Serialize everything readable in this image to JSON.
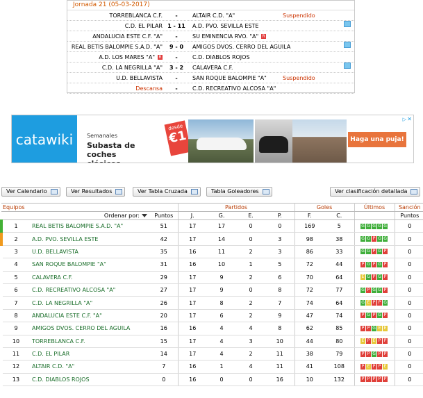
{
  "jornada": {
    "title": "Jornada 21 (05-03-2017)",
    "matches": [
      {
        "home": "TORREBLANCA C.F.",
        "score": "-",
        "away": "ALTAIR C.D. \"A\"",
        "status": "Suspendido",
        "badge": "",
        "icon": false
      },
      {
        "home": "C.D. EL PILAR",
        "score": "1 - 11",
        "away": "A.D. PVO. SEVILLA ESTE",
        "status": "",
        "badge": "",
        "icon": true
      },
      {
        "home": "ANDALUCIA ESTE C.F. \"A\"",
        "score": "-",
        "away": "SU EMINENCIA RVO. \"A\"",
        "status": "",
        "badge": "R",
        "icon": false
      },
      {
        "home": "REAL BETIS BALOMPIE S.A.D. \"A\"",
        "score": "9 - 0",
        "away": "AMIGOS DVOS. CERRO DEL AGUILA",
        "status": "",
        "badge": "",
        "icon": true
      },
      {
        "home": "A.D. LOS MARES \"A\"",
        "score": "-",
        "away": "C.D. DIABLOS ROJOS",
        "status": "",
        "badge": "R",
        "badge_home": true,
        "icon": false
      },
      {
        "home": "C.D. LA NEGRILLA \"A\"",
        "score": "3 - 2",
        "away": "CALAVERA C.F.",
        "status": "",
        "badge": "",
        "icon": true
      },
      {
        "home": "U.D. BELLAVISTA",
        "score": "-",
        "away": "SAN ROQUE BALOMPIE \"A\"",
        "status": "Suspendido",
        "badge": "",
        "icon": false
      },
      {
        "home": "Descansa",
        "score": "-",
        "away": "C.D. RECREATIVO ALCOSA \"A\"",
        "status": "",
        "badge": "",
        "icon": false,
        "descansa": true
      }
    ]
  },
  "ad": {
    "logo": "catawiki",
    "line1": "Semanales",
    "line2": "Subasta de coches clásicos",
    "price_prefix": "desde",
    "price": "€1",
    "cta": "Haga una puja! »",
    "info_icon": "info-icon",
    "close": "✕"
  },
  "buttons": {
    "calendario": "Ver Calendario",
    "resultados": "Ver Resultados",
    "cruzada": "Ver Tabla Cruzada",
    "goleadores": "Tabla Goleadores",
    "detallada": "Ver clasificación detallada"
  },
  "table": {
    "groups": {
      "equipos": "Equipos",
      "partidos": "Partidos",
      "goles": "Goles",
      "ultimos": "Últimos",
      "sancion": "Sanción"
    },
    "sub": {
      "ordenar": "Ordenar por:",
      "puntos": "Puntos",
      "j": "J.",
      "g": "G.",
      "e": "E.",
      "p": "P.",
      "f": "F.",
      "c": "C.",
      "sancion_puntos": "Puntos"
    },
    "rows": [
      {
        "pos": "1",
        "mark": "green",
        "team": "REAL BETIS BALOMPIE S.A.D. \"A\"",
        "pts": "51",
        "j": "17",
        "g": "17",
        "e": "0",
        "p": "0",
        "f": "169",
        "c": "5",
        "form": [
          "G",
          "G",
          "G",
          "G",
          "G"
        ],
        "san": "0"
      },
      {
        "pos": "2",
        "mark": "orange",
        "team": "A.D. PVO. SEVILLA ESTE",
        "pts": "42",
        "j": "17",
        "g": "14",
        "e": "0",
        "p": "3",
        "f": "98",
        "c": "38",
        "form": [
          "G",
          "G",
          "P",
          "G",
          "G"
        ],
        "san": "0"
      },
      {
        "pos": "3",
        "mark": "",
        "team": "U.D. BELLAVISTA",
        "pts": "35",
        "j": "16",
        "g": "11",
        "e": "2",
        "p": "3",
        "f": "86",
        "c": "33",
        "form": [
          "G",
          "G",
          "P",
          "G",
          "P"
        ],
        "san": "0"
      },
      {
        "pos": "4",
        "mark": "",
        "team": "SAN ROQUE BALOMPIE \"A\"",
        "pts": "31",
        "j": "16",
        "g": "10",
        "e": "1",
        "p": "5",
        "f": "72",
        "c": "44",
        "form": [
          "P",
          "G",
          "P",
          "G",
          "P"
        ],
        "san": "0"
      },
      {
        "pos": "5",
        "mark": "",
        "team": "CALAVERA C.F.",
        "pts": "29",
        "j": "17",
        "g": "9",
        "e": "2",
        "p": "6",
        "f": "70",
        "c": "64",
        "form": [
          "E",
          "G",
          "P",
          "G",
          "P"
        ],
        "san": "0"
      },
      {
        "pos": "6",
        "mark": "",
        "team": "C.D. RECREATIVO ALCOSA \"A\"",
        "pts": "27",
        "j": "17",
        "g": "9",
        "e": "0",
        "p": "8",
        "f": "72",
        "c": "77",
        "form": [
          "G",
          "P",
          "G",
          "G",
          "P"
        ],
        "san": "0"
      },
      {
        "pos": "7",
        "mark": "",
        "team": "C.D. LA NEGRILLA \"A\"",
        "pts": "26",
        "j": "17",
        "g": "8",
        "e": "2",
        "p": "7",
        "f": "74",
        "c": "64",
        "form": [
          "G",
          "E",
          "P",
          "P",
          "G"
        ],
        "san": "0"
      },
      {
        "pos": "8",
        "mark": "",
        "team": "ANDALUCIA ESTE C.F. \"A\"",
        "pts": "20",
        "j": "17",
        "g": "6",
        "e": "2",
        "p": "9",
        "f": "47",
        "c": "74",
        "form": [
          "P",
          "G",
          "P",
          "G",
          "P"
        ],
        "san": "0"
      },
      {
        "pos": "9",
        "mark": "",
        "team": "AMIGOS DVOS. CERRO DEL AGUILA",
        "pts": "16",
        "j": "16",
        "g": "4",
        "e": "4",
        "p": "8",
        "f": "62",
        "c": "85",
        "form": [
          "P",
          "P",
          "G",
          "E",
          "E"
        ],
        "san": "0"
      },
      {
        "pos": "10",
        "mark": "",
        "team": "TORREBLANCA C.F.",
        "pts": "15",
        "j": "17",
        "g": "4",
        "e": "3",
        "p": "10",
        "f": "44",
        "c": "80",
        "form": [
          "E",
          "P",
          "E",
          "P",
          "P"
        ],
        "san": "0"
      },
      {
        "pos": "11",
        "mark": "",
        "team": "C.D. EL PILAR",
        "pts": "14",
        "j": "17",
        "g": "4",
        "e": "2",
        "p": "11",
        "f": "38",
        "c": "79",
        "form": [
          "P",
          "P",
          "G",
          "P",
          "P"
        ],
        "san": "0"
      },
      {
        "pos": "12",
        "mark": "",
        "team": "ALTAIR C.D. \"A\"",
        "pts": "7",
        "j": "16",
        "g": "1",
        "e": "4",
        "p": "11",
        "f": "41",
        "c": "108",
        "form": [
          "P",
          "E",
          "P",
          "P",
          "E"
        ],
        "san": "0"
      },
      {
        "pos": "13",
        "mark": "",
        "team": "C.D. DIABLOS ROJOS",
        "pts": "0",
        "j": "16",
        "g": "0",
        "e": "0",
        "p": "16",
        "f": "10",
        "c": "132",
        "form": [
          "P",
          "P",
          "P",
          "P",
          "P"
        ],
        "san": "0"
      }
    ]
  }
}
